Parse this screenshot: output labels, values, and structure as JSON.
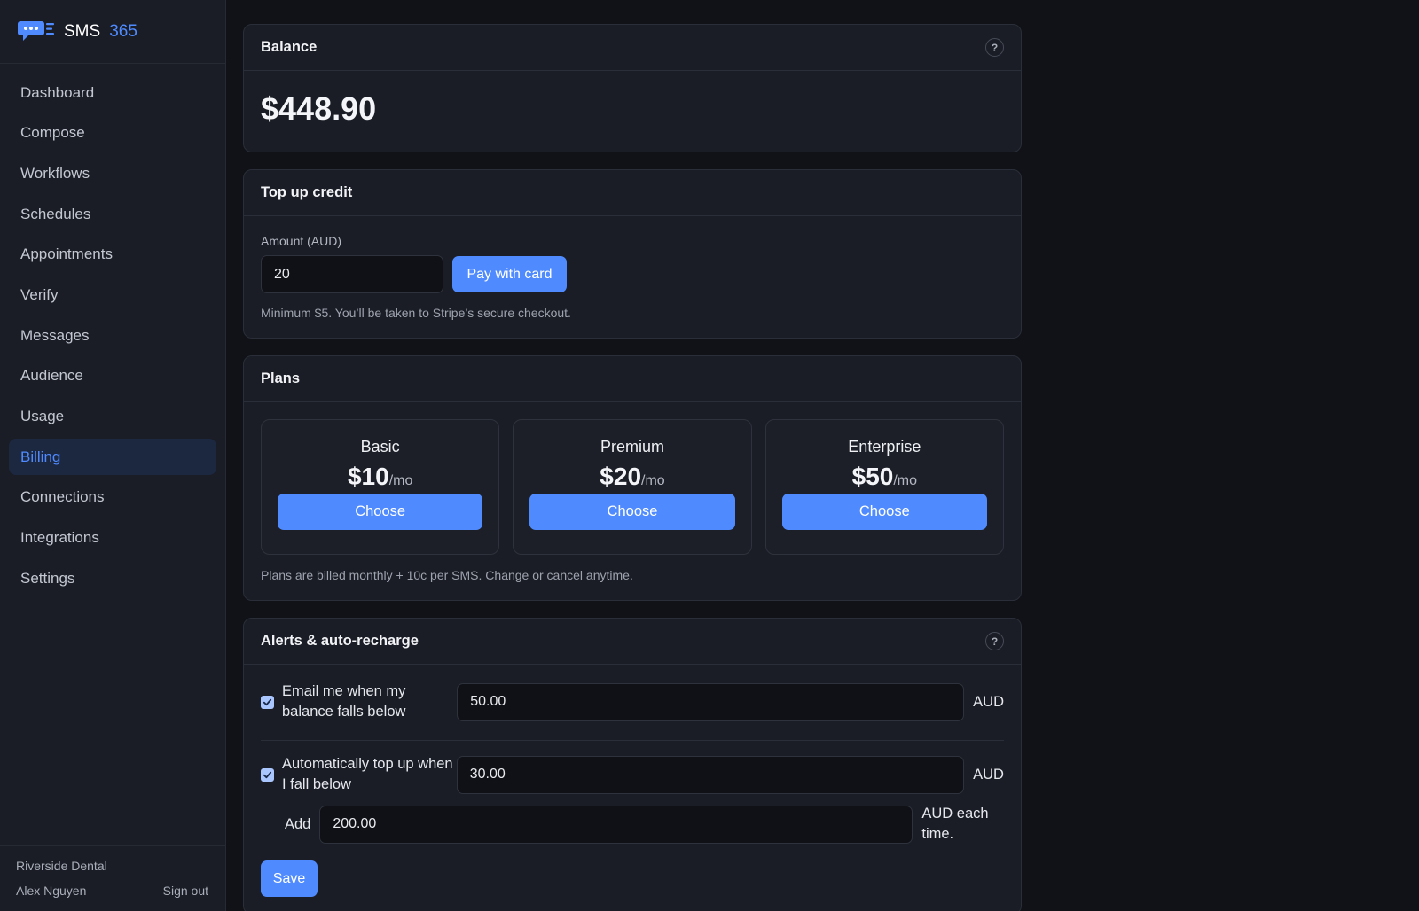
{
  "brand": {
    "name": "SMS",
    "number": "365",
    "icon": "chat-bubble-logo-icon"
  },
  "nav": {
    "items": [
      {
        "label": "Dashboard",
        "active": false
      },
      {
        "label": "Compose",
        "active": false
      },
      {
        "label": "Workflows",
        "active": false
      },
      {
        "label": "Schedules",
        "active": false
      },
      {
        "label": "Appointments",
        "active": false
      },
      {
        "label": "Verify",
        "active": false
      },
      {
        "label": "Messages",
        "active": false
      },
      {
        "label": "Audience",
        "active": false
      },
      {
        "label": "Usage",
        "active": false
      },
      {
        "label": "Billing",
        "active": true
      },
      {
        "label": "Connections",
        "active": false
      },
      {
        "label": "Integrations",
        "active": false
      },
      {
        "label": "Settings",
        "active": false
      }
    ]
  },
  "footer": {
    "org": "Riverside Dental",
    "user": "Alex Nguyen",
    "sign_out": "Sign out"
  },
  "balance": {
    "title": "Balance",
    "amount": "$448.90",
    "help": "?"
  },
  "topup": {
    "title": "Top up credit",
    "amount_label": "Amount (AUD)",
    "amount_value": "20",
    "pay_button": "Pay with card",
    "hint": "Minimum $5. You’ll be taken to Stripe’s secure checkout."
  },
  "plans": {
    "title": "Plans",
    "items": [
      {
        "name": "Basic",
        "price": "$10",
        "per": "/mo",
        "button": "Choose"
      },
      {
        "name": "Premium",
        "price": "$20",
        "per": "/mo",
        "button": "Choose"
      },
      {
        "name": "Enterprise",
        "price": "$50",
        "per": "/mo",
        "button": "Choose"
      }
    ],
    "note": "Plans are billed monthly + 10c per SMS. Change or cancel anytime."
  },
  "alerts": {
    "title": "Alerts & auto-recharge",
    "help": "?",
    "email_alert": {
      "checked": true,
      "label": "Email me when my balance falls below",
      "value": "50.00",
      "unit": "AUD"
    },
    "auto_topup": {
      "checked": true,
      "label": "Automatically top up when I fall below",
      "value": "30.00",
      "unit": "AUD"
    },
    "add": {
      "label": "Add",
      "value": "200.00",
      "suffix": "AUD each time."
    },
    "save_button": "Save"
  },
  "colors": {
    "accent": "#4f8bff",
    "background": "#101217",
    "panel": "#1a1d25"
  }
}
